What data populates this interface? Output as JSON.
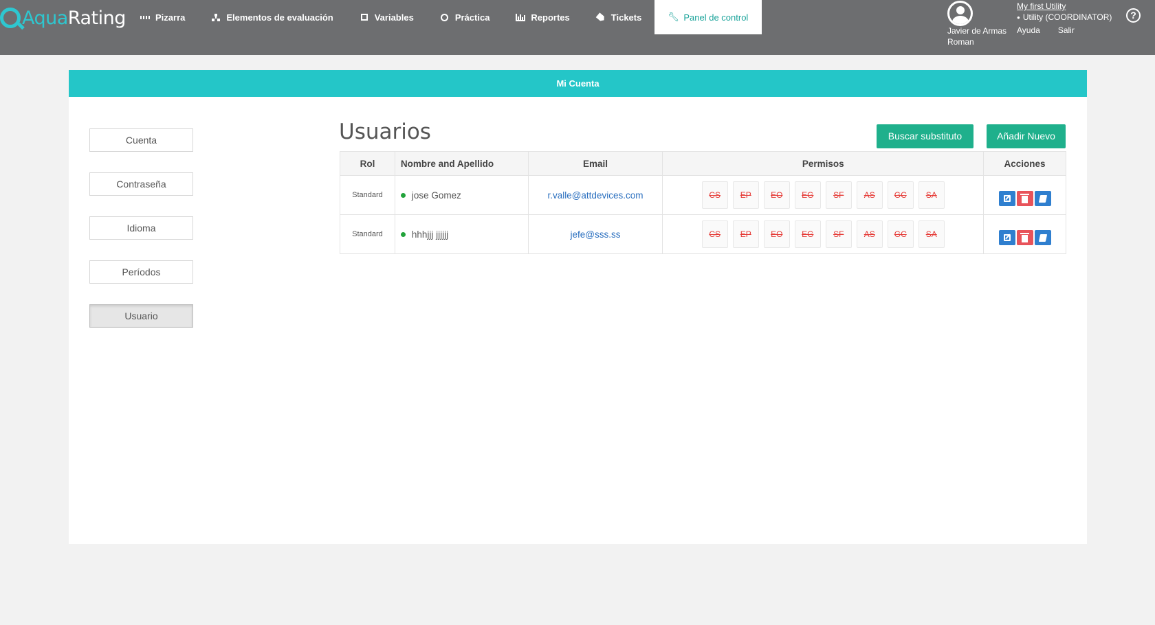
{
  "brand": {
    "aqua": "Aqua",
    "rating": "Rating"
  },
  "nav": {
    "items": [
      {
        "label": "Pizarra",
        "icon": "dashboard-icon"
      },
      {
        "label": "Elementos de evaluación",
        "icon": "sitemap-icon"
      },
      {
        "label": "Variables",
        "icon": "square-icon"
      },
      {
        "label": "Práctica",
        "icon": "circle-icon"
      },
      {
        "label": "Reportes",
        "icon": "bar-chart-icon"
      },
      {
        "label": "Tickets",
        "icon": "tags-icon"
      },
      {
        "label": "Panel de control",
        "icon": "wrench-icon",
        "active": true
      }
    ]
  },
  "user": {
    "name_line1": "Javier de Armas",
    "name_line2": "Roman"
  },
  "utility": {
    "link": "My first Utility",
    "role": "Utility (COORDINATOR)",
    "help": "Ayuda",
    "logout": "Salir"
  },
  "panel": {
    "title": "Mi Cuenta"
  },
  "side_menu": [
    {
      "label": "Cuenta"
    },
    {
      "label": "Contraseña"
    },
    {
      "label": "Idioma"
    },
    {
      "label": "Períodos"
    },
    {
      "label": "Usuario",
      "active": true
    }
  ],
  "section": {
    "title": "Usuarios",
    "buscar_label": "Buscar substituto",
    "anadir_label": "Añadir Nuevo"
  },
  "table": {
    "headers": {
      "rol": "Rol",
      "nombre": "Nombre and Apellido",
      "email": "Email",
      "permisos": "Permisos",
      "acciones": "Acciones"
    },
    "rows": [
      {
        "rol": "Standard",
        "nombre": "jose Gomez",
        "email": "r.valle@attdevices.com",
        "permisos": [
          "CS",
          "EP",
          "EO",
          "EG",
          "SF",
          "AS",
          "GC",
          "SA"
        ]
      },
      {
        "rol": "Standard",
        "nombre": "hhhjjj jjjjjj",
        "email": "jefe@sss.ss",
        "permisos": [
          "CS",
          "EP",
          "EO",
          "EG",
          "SF",
          "AS",
          "GC",
          "SA"
        ]
      }
    ]
  },
  "colors": {
    "navbar": "#6d6e70",
    "accent_teal": "#24c6c8",
    "button_green": "#1fb08c",
    "permission_red": "#e53935",
    "action_blue": "#2f7fcf",
    "action_red": "#e8535a",
    "status_dot": "#22a33b"
  }
}
